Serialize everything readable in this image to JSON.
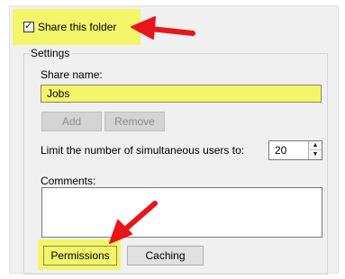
{
  "share": {
    "checked": true,
    "label": "Share this folder"
  },
  "settings": {
    "title": "Settings",
    "share_name_label": "Share name:",
    "share_name_value": "Jobs",
    "add_label": "Add",
    "remove_label": "Remove",
    "limit_label": "Limit the number of simultaneous users to:",
    "limit_value": "20",
    "comments_label": "Comments:",
    "comments_value": "",
    "permissions_label": "Permissions",
    "caching_label": "Caching"
  },
  "colors": {
    "highlight": "#f3f56a",
    "arrow": "#e8151b"
  },
  "icons": {
    "checkbox": "check-mark-icon",
    "spin_up": "up-triangle-icon",
    "spin_down": "down-triangle-icon",
    "callout": "red-arrow-icon"
  }
}
